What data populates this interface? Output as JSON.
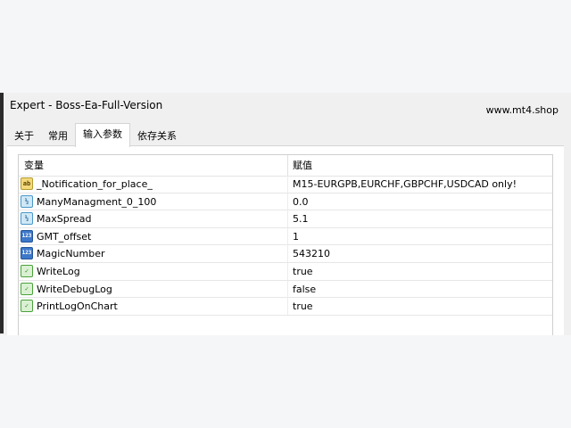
{
  "window": {
    "title": "Expert - Boss-Ea-Full-Version",
    "site": "www.mt4.shop"
  },
  "tabs": [
    {
      "label": "关于",
      "active": false
    },
    {
      "label": "常用",
      "active": false
    },
    {
      "label": "输入参数",
      "active": true
    },
    {
      "label": "依存关系",
      "active": false
    }
  ],
  "table": {
    "columns": [
      "变量",
      "赋值"
    ],
    "rows": [
      {
        "icon": "ab-string-icon",
        "icon_text": "ab",
        "name": "_Notification_for_place_",
        "value": "M15-EURGPB,EURCHF,GBPCHF,USDCAD only!"
      },
      {
        "icon": "double-icon",
        "icon_text": "½",
        "name": "ManyManagment_0_100",
        "value": "0.0"
      },
      {
        "icon": "double-icon",
        "icon_text": "½",
        "name": "MaxSpread",
        "value": "5.1"
      },
      {
        "icon": "integer-icon",
        "icon_text": "123",
        "name": "GMT_offset",
        "value": "1"
      },
      {
        "icon": "integer-icon",
        "icon_text": "123",
        "name": "MagicNumber",
        "value": "543210"
      },
      {
        "icon": "bool-icon",
        "icon_text": "✓",
        "name": "WriteLog",
        "value": "true"
      },
      {
        "icon": "bool-icon",
        "icon_text": "✓",
        "name": "WriteDebugLog",
        "value": "false"
      },
      {
        "icon": "bool-icon",
        "icon_text": "✓",
        "name": "PrintLogOnChart",
        "value": "true"
      }
    ]
  }
}
